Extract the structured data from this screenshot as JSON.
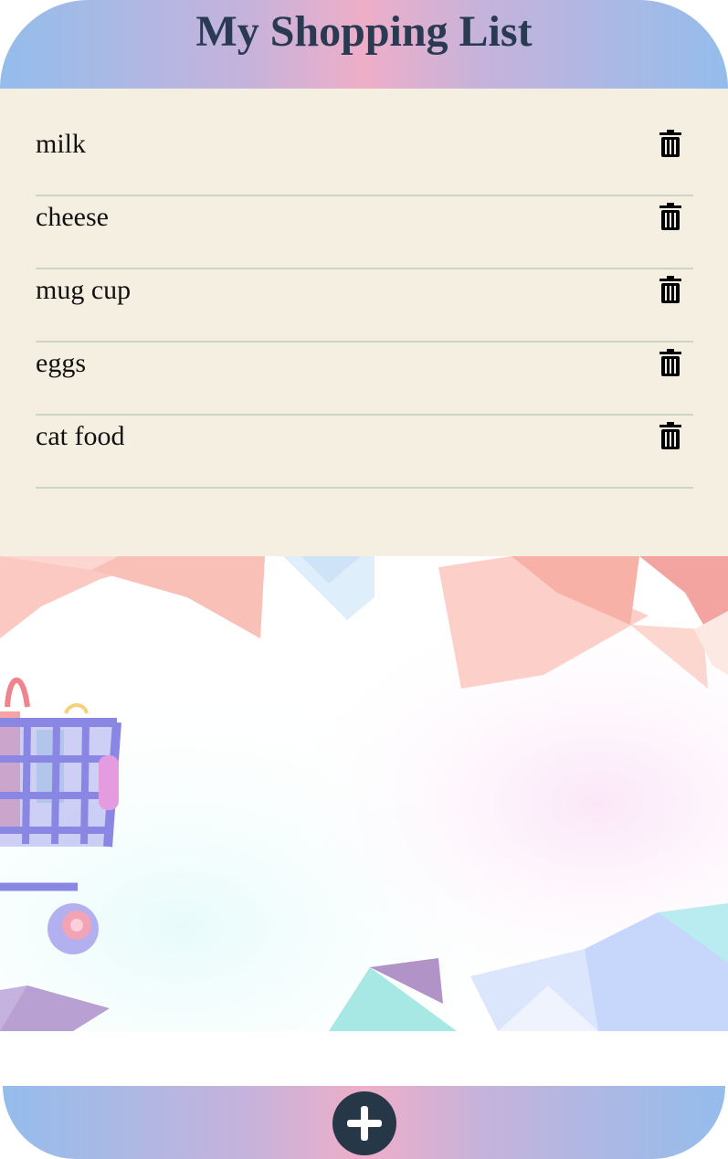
{
  "header": {
    "title": "My Shopping List"
  },
  "list": {
    "items": [
      {
        "label": "milk"
      },
      {
        "label": "cheese"
      },
      {
        "label": "mug cup"
      },
      {
        "label": "eggs"
      },
      {
        "label": "cat food"
      }
    ]
  },
  "icons": {
    "delete": "trash-icon",
    "add": "plus-icon",
    "illustration": "shopping-cart-icon"
  },
  "colors": {
    "header_gradient": [
      "#94bdec",
      "#eeaec8",
      "#94bdec"
    ],
    "title": "#2a3a52",
    "panel_background": "#f5efe2",
    "divider": "#cdd6c6",
    "add_button": "#263748"
  }
}
